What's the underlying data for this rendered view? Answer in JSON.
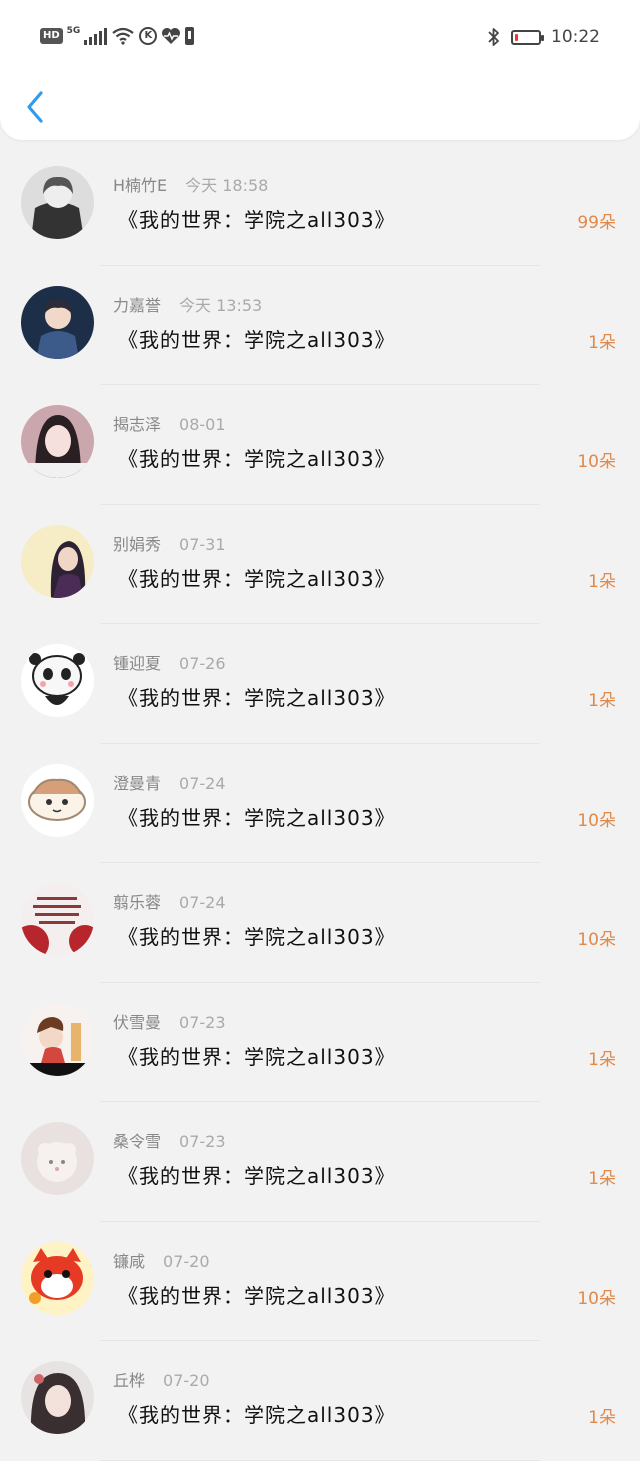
{
  "status_bar": {
    "hd": "HD",
    "network": "5G",
    "time": "10:22",
    "battery_level_percent": 12,
    "icons": [
      "hd-icon",
      "signal-icon",
      "wifi-icon",
      "k-icon",
      "health-icon",
      "battery-small-icon",
      "bluetooth-icon",
      "battery-icon"
    ]
  },
  "header": {
    "back_icon": "chevron-left-icon"
  },
  "colors": {
    "accent": "#2f9cf0",
    "count": "#e0894a",
    "battery_low": "#e53935"
  },
  "list": [
    {
      "name": "H楠竹E",
      "time": "今天 18:58",
      "title": "《我的世界：学院之all303》",
      "count": "99朵"
    },
    {
      "name": "力嘉誉",
      "time": "今天 13:53",
      "title": "《我的世界：学院之all303》",
      "count": "1朵"
    },
    {
      "name": "揭志泽",
      "time": "08-01",
      "title": "《我的世界：学院之all303》",
      "count": "10朵"
    },
    {
      "name": "别娟秀",
      "time": "07-31",
      "title": "《我的世界：学院之all303》",
      "count": "1朵"
    },
    {
      "name": "锺迎夏",
      "time": "07-26",
      "title": "《我的世界：学院之all303》",
      "count": "1朵"
    },
    {
      "name": "澄曼青",
      "time": "07-24",
      "title": "《我的世界：学院之all303》",
      "count": "10朵"
    },
    {
      "name": "翦乐蓉",
      "time": "07-24",
      "title": "《我的世界：学院之all303》",
      "count": "10朵"
    },
    {
      "name": "伏雪曼",
      "time": "07-23",
      "title": "《我的世界：学院之all303》",
      "count": "1朵"
    },
    {
      "name": "桑令雪",
      "time": "07-23",
      "title": "《我的世界：学院之all303》",
      "count": "1朵"
    },
    {
      "name": "镰咸",
      "time": "07-20",
      "title": "《我的世界：学院之all303》",
      "count": "10朵"
    },
    {
      "name": "丘桦",
      "time": "07-20",
      "title": "《我的世界：学院之all303》",
      "count": "1朵"
    }
  ]
}
